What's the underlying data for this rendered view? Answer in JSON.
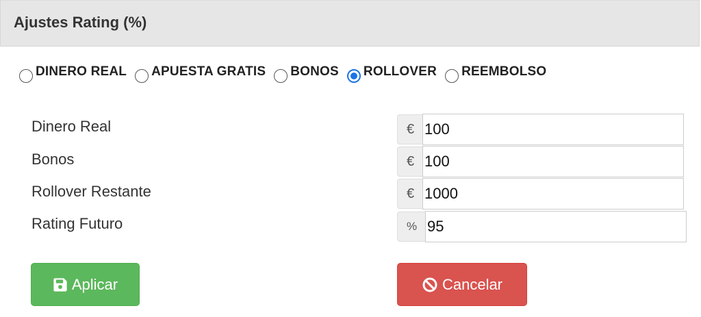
{
  "panel": {
    "title": "Ajustes Rating (%)"
  },
  "radio_options": [
    {
      "label": "DINERO REAL",
      "checked": false
    },
    {
      "label": "APUESTA GRATIS",
      "checked": false
    },
    {
      "label": "BONOS",
      "checked": false
    },
    {
      "label": "ROLLOVER",
      "checked": true
    },
    {
      "label": "REEMBOLSO",
      "checked": false
    }
  ],
  "fields": [
    {
      "label": "Dinero Real",
      "addon": "€",
      "value": "100"
    },
    {
      "label": "Bonos",
      "addon": "€",
      "value": "100"
    },
    {
      "label": "Rollover Restante",
      "addon": "€",
      "value": "1000"
    },
    {
      "label": "Rating Futuro",
      "addon": "%",
      "value": "95"
    }
  ],
  "buttons": {
    "apply_label": "Aplicar",
    "apply_icon": "save-icon",
    "cancel_label": "Cancelar",
    "cancel_icon": "ban-icon"
  },
  "colors": {
    "apply": "#5cb85c",
    "cancel": "#d9534f",
    "radio_checked": "#1a73e8"
  }
}
